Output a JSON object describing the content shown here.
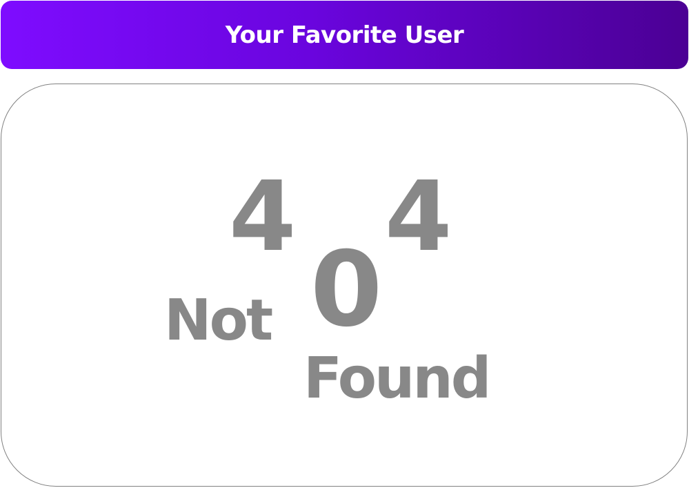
{
  "header": {
    "title": "Your Favorite User"
  },
  "not_found": {
    "digit_first": "4",
    "digit_middle": "0",
    "digit_last": "4",
    "word_not": "Not",
    "word_found": "Found"
  },
  "colors": {
    "header_gradient_start": "#7e0cff",
    "header_gradient_end": "#4b0094",
    "header_text": "#ffffff",
    "error_text": "#888888",
    "card_border": "#808080"
  }
}
